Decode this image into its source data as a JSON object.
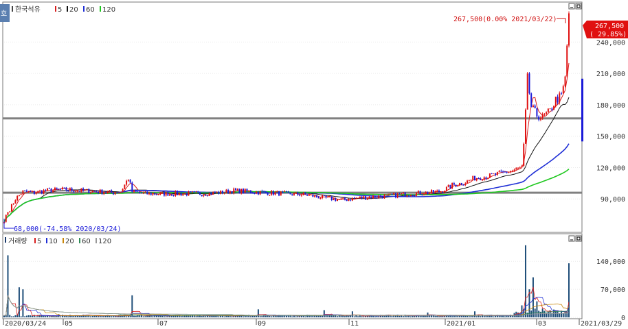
{
  "header_price": {
    "hoga_icon": "호",
    "stock_name": "한국석유",
    "ma_legend": [
      {
        "label": "5",
        "color": "#d81e1e"
      },
      {
        "label": "20",
        "color": "#111111"
      },
      {
        "label": "60",
        "color": "#1f2fd6"
      },
      {
        "label": "120",
        "color": "#1ec81e"
      }
    ]
  },
  "header_volume": {
    "title": "거래량",
    "ma_legend": [
      {
        "label": "5",
        "color": "#d81e1e"
      },
      {
        "label": "10",
        "color": "#1f2fd6"
      },
      {
        "label": "20",
        "color": "#c8860a"
      },
      {
        "label": "60",
        "color": "#2e8b57"
      },
      {
        "label": "120",
        "color": "#999999"
      }
    ]
  },
  "annotations": {
    "high": "267,500(0.00% 2021/03/22)",
    "low": "68,000(-74.58% 2020/03/24)",
    "last_price": "267,500",
    "last_change": "( 29.85%)"
  },
  "axis": {
    "price_ticks": [
      "240,000",
      "210,000",
      "180,000",
      "150,000",
      "120,000",
      "90,000"
    ],
    "volume_ticks": [
      "140,000",
      "70,000",
      "0"
    ],
    "date_labels": [
      "2020/03/24",
      "05",
      "07",
      "09",
      "11",
      "2021/01",
      "03",
      "2021/03/29"
    ]
  },
  "colors": {
    "up": "#e01010",
    "down": "#1a1ad8",
    "ma5": "#d81e1e",
    "ma20": "#111111",
    "ma60": "#1f2fd6",
    "ma120": "#1ec81e",
    "support_line": "#808080"
  },
  "chart_data": {
    "type": "candlestick",
    "stock": "한국석유",
    "x_range": [
      "2020/03/24",
      "2021/03/29"
    ],
    "price_axis": {
      "ticks": [
        90000,
        120000,
        150000,
        180000,
        210000,
        240000
      ],
      "range": [
        60000,
        275000
      ]
    },
    "volume_axis": {
      "ticks": [
        0,
        70000,
        140000
      ],
      "range": [
        0,
        190000
      ]
    },
    "horizontal_lines": [
      96000,
      167000
    ],
    "last_price": 267500,
    "last_change_pct": 29.85,
    "high": {
      "date": "2021/03/22",
      "value": 267500
    },
    "low": {
      "date": "2020/03/24",
      "value": 68000
    },
    "price_keypoints": [
      [
        0,
        72000
      ],
      [
        3,
        80000
      ],
      [
        6,
        90000
      ],
      [
        10,
        97000
      ],
      [
        16,
        96000
      ],
      [
        22,
        98000
      ],
      [
        30,
        99000
      ],
      [
        40,
        98000
      ],
      [
        50,
        97000
      ],
      [
        58,
        96000
      ],
      [
        62,
        97000
      ],
      [
        66,
        110000
      ],
      [
        68,
        97000
      ],
      [
        75,
        95000
      ],
      [
        85,
        95000
      ],
      [
        95,
        95000
      ],
      [
        105,
        95000
      ],
      [
        115,
        96000
      ],
      [
        122,
        98000
      ],
      [
        130,
        97000
      ],
      [
        140,
        96000
      ],
      [
        150,
        95000
      ],
      [
        160,
        94000
      ],
      [
        170,
        91000
      ],
      [
        180,
        89000
      ],
      [
        188,
        91000
      ],
      [
        195,
        92000
      ],
      [
        205,
        93000
      ],
      [
        215,
        95000
      ],
      [
        225,
        96000
      ],
      [
        232,
        97000
      ],
      [
        238,
        103000
      ],
      [
        245,
        106000
      ],
      [
        250,
        110000
      ],
      [
        258,
        112000
      ],
      [
        265,
        115000
      ],
      [
        270,
        117000
      ],
      [
        275,
        120000
      ],
      [
        276,
        140000
      ],
      [
        278,
        205000
      ],
      [
        280,
        178000
      ],
      [
        283,
        170000
      ],
      [
        286,
        168000
      ],
      [
        290,
        174000
      ],
      [
        293,
        185000
      ],
      [
        296,
        188000
      ],
      [
        298,
        205000
      ],
      [
        300,
        267500
      ]
    ],
    "volume_spikes": [
      [
        2,
        155000
      ],
      [
        8,
        75000
      ],
      [
        10,
        70000
      ],
      [
        68,
        55000
      ],
      [
        135,
        20000
      ],
      [
        170,
        18000
      ],
      [
        185,
        15000
      ],
      [
        225,
        12000
      ],
      [
        250,
        15000
      ],
      [
        275,
        30000
      ],
      [
        277,
        180000
      ],
      [
        279,
        70000
      ],
      [
        281,
        100000
      ],
      [
        283,
        40000
      ],
      [
        300,
        135000
      ]
    ],
    "moving_averages_price": [
      5,
      20,
      60,
      120
    ],
    "moving_averages_volume": [
      5,
      10,
      20,
      60,
      120
    ]
  }
}
